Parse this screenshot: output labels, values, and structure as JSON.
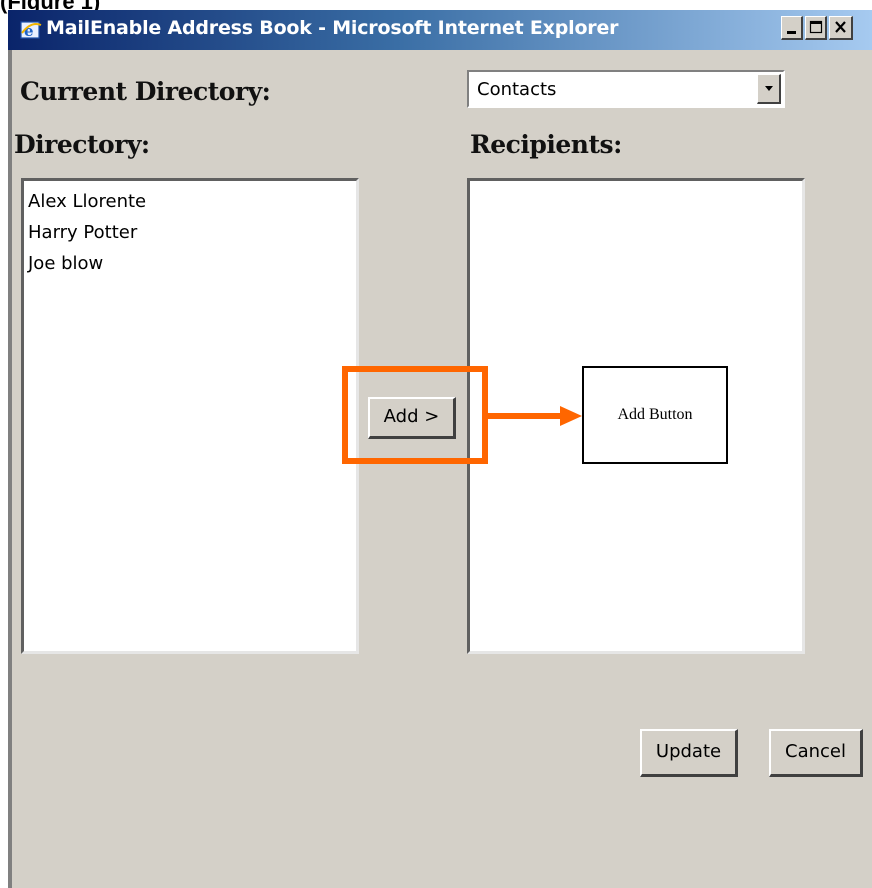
{
  "figure_caption": "(Figure 1)",
  "window": {
    "title": "MailEnable Address Book - Microsoft Internet Explorer",
    "icon": "ie-icon",
    "controls": [
      "minimize-icon",
      "maximize-icon",
      "close-icon"
    ]
  },
  "form": {
    "current_directory_label": "Current Directory:",
    "directory_select": {
      "selected": "Contacts",
      "icon": "chevron-down-icon"
    },
    "directory_label": "Directory:",
    "recipients_label": "Recipients:",
    "directory_list": [
      "Alex Llorente",
      "Harry Potter",
      "Joe blow"
    ],
    "recipients_list": [],
    "add_button": "Add >",
    "update_button": "Update",
    "cancel_button": "Cancel"
  },
  "annotation": {
    "callout_text": "Add Button",
    "highlight_color": "#ff6600"
  },
  "colors": {
    "window_face": "#d4d0c8",
    "titlebar_start": "#0a246a",
    "titlebar_end": "#a6caf0"
  }
}
